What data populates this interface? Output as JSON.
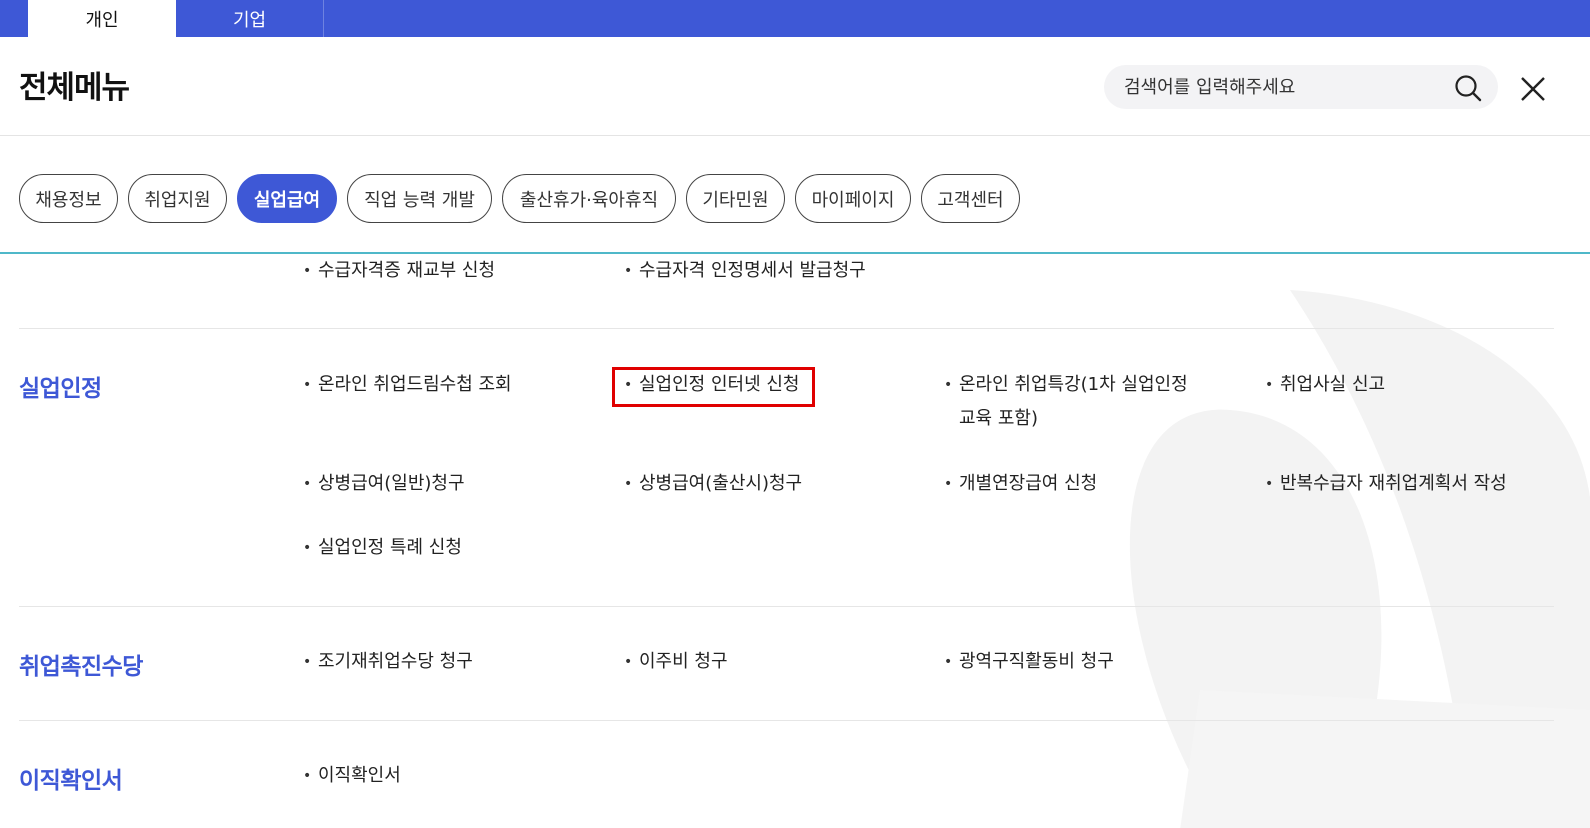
{
  "top_tabs": {
    "personal": "개인",
    "business": "기업"
  },
  "header": {
    "title": "전체메뉴",
    "search_placeholder": "검색어를 입력해주세요"
  },
  "categories": [
    "채용정보",
    "취업지원",
    "실업급여",
    "직업 능력 개발",
    "출산휴가·육아휴직",
    "기타민원",
    "마이페이지",
    "고객센터"
  ],
  "active_category": "실업급여",
  "bullet": "•",
  "partial_section": {
    "items": [
      "수급자격증 재교부 신청",
      "수급자격 인정명세서 발급청구"
    ]
  },
  "sections": [
    {
      "title": "실업인정",
      "items": [
        "온라인 취업드림수첩 조회",
        "실업인정 인터넷 신청",
        "온라인 취업특강(1차 실업인정",
        "교육 포함)",
        "취업사실 신고",
        "상병급여(일반)청구",
        "상병급여(출산시)청구",
        "개별연장급여 신청",
        "반복수급자 재취업계획서 작성",
        "실업인정 특례 신청"
      ]
    },
    {
      "title": "취업촉진수당",
      "items": [
        "조기재취업수당 청구",
        "이주비 청구",
        "광역구직활동비 청구"
      ]
    },
    {
      "title": "이직확인서",
      "items": [
        "이직확인서"
      ]
    }
  ],
  "highlighted_item": "실업인정 인터넷 신청",
  "colors": {
    "primary": "#3e58d6",
    "highlight": "#e00000",
    "divider_accent": "#4fb8c9"
  }
}
